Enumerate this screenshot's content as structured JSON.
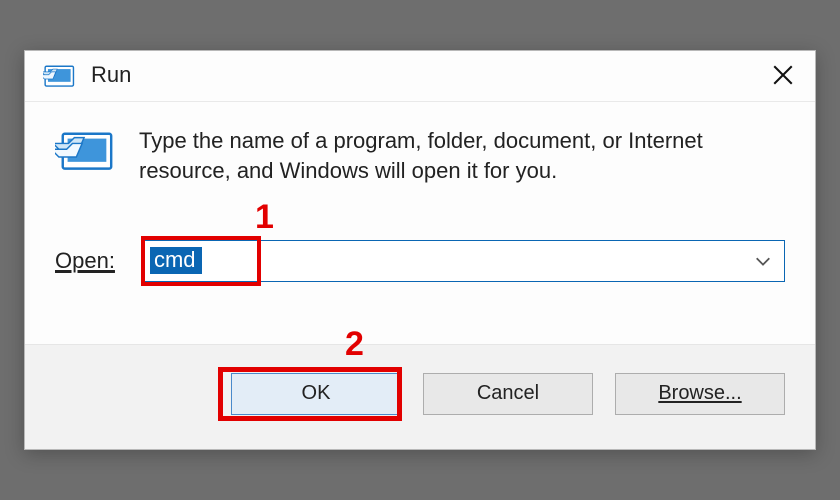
{
  "window": {
    "title": "Run",
    "close_tooltip": "Close"
  },
  "description": "Type the name of a program, folder, document, or Internet resource, and Windows will open it for you.",
  "open_label": "Open:",
  "input_value": "cmd",
  "buttons": {
    "ok": "OK",
    "cancel": "Cancel",
    "browse": "Browse..."
  },
  "annotations": {
    "step1": "1",
    "step2": "2",
    "highlight_color": "#e20000"
  },
  "colors": {
    "accent": "#0a66b3"
  }
}
